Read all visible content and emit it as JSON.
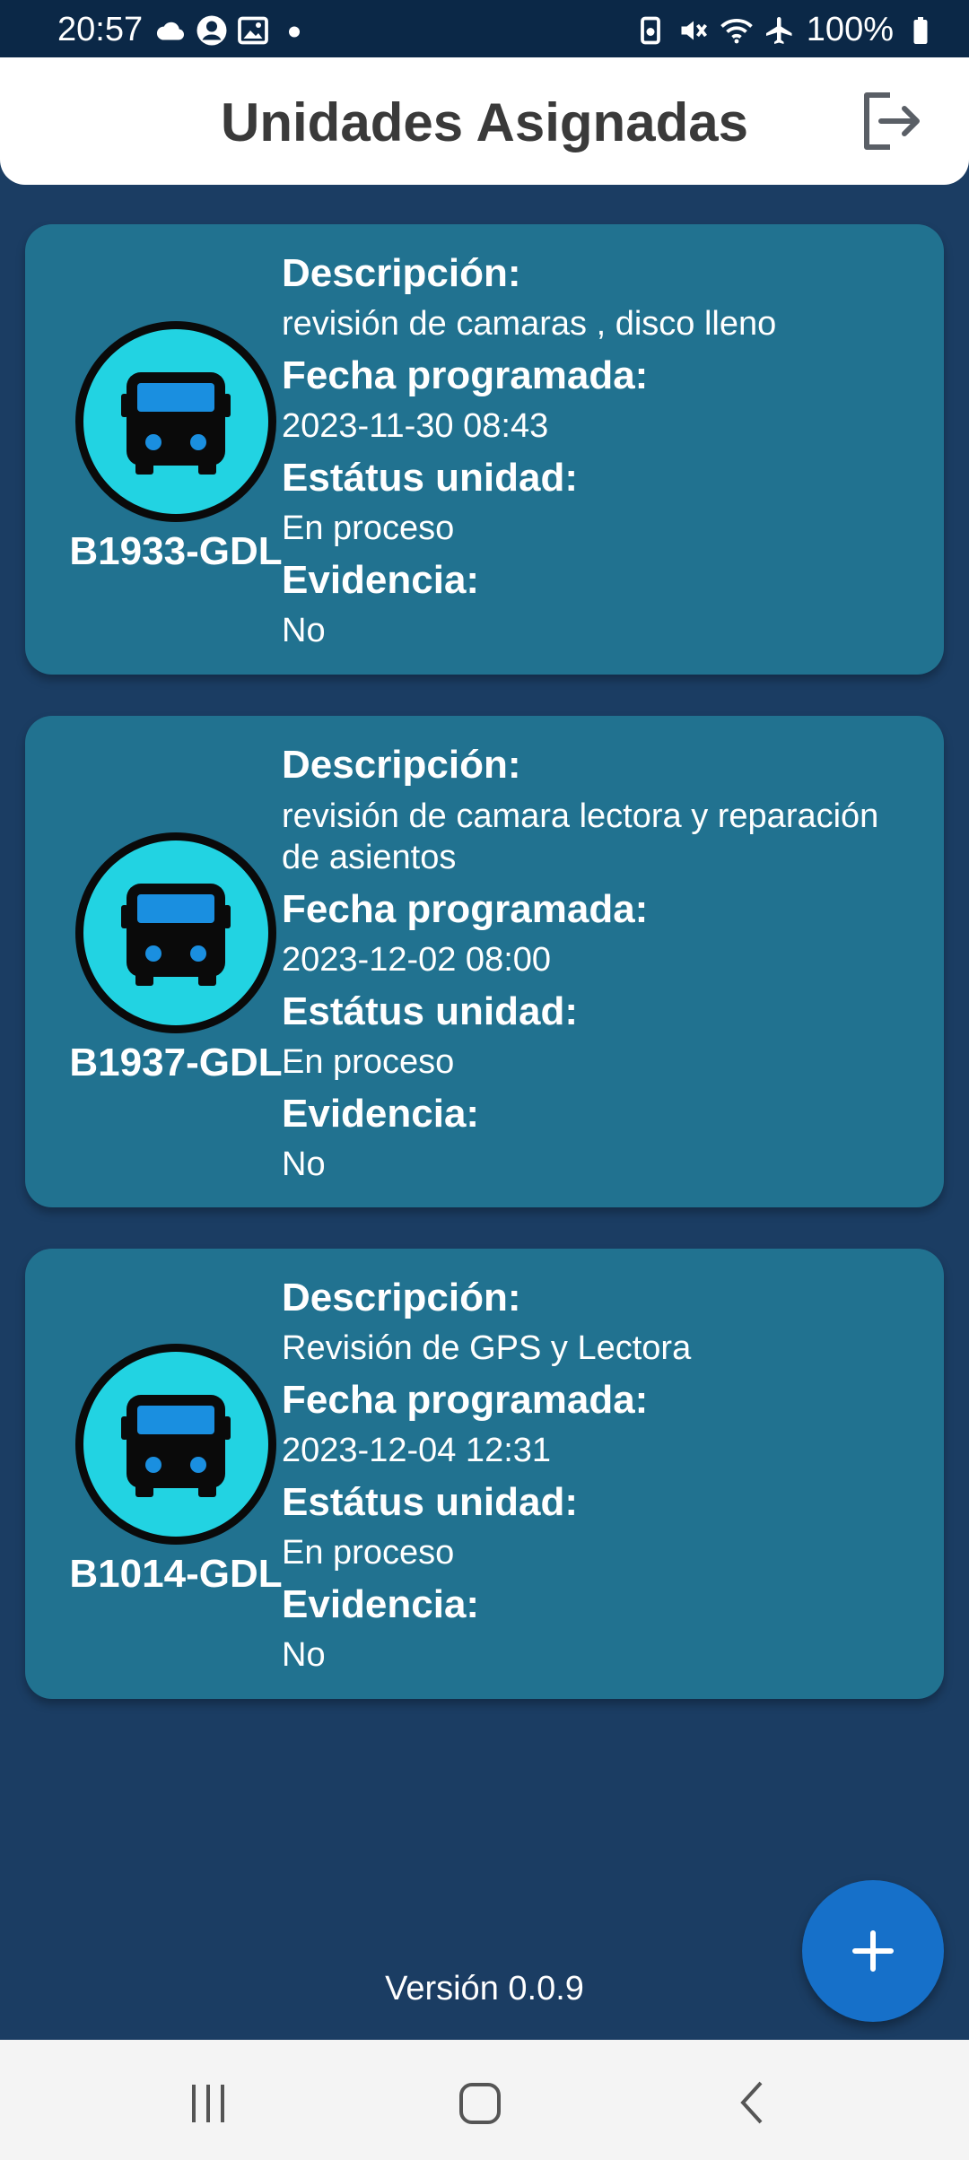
{
  "status_bar": {
    "time": "20:57",
    "battery": "100%",
    "icons_left": [
      "cloud-icon",
      "account-icon",
      "image-icon",
      "dot-icon"
    ],
    "icons_right": [
      "nfc-icon",
      "mute-icon",
      "wifi-icon",
      "airplane-icon",
      "battery-icon"
    ]
  },
  "header": {
    "title": "Unidades Asignadas",
    "logout_icon": "logout-icon"
  },
  "labels": {
    "descripcion": "Descripción:",
    "fecha": "Fecha programada:",
    "estatus": "Estátus unidad:",
    "evidencia": "Evidencia:"
  },
  "cards": [
    {
      "unit": "B1933-GDL",
      "descripcion": "revisión de camaras , disco lleno",
      "fecha": "2023-11-30  08:43",
      "estatus": "En proceso",
      "evidencia": "No"
    },
    {
      "unit": "B1937-GDL",
      "descripcion": "revisión de camara lectora y reparación de asientos",
      "fecha": "2023-12-02  08:00",
      "estatus": "En proceso",
      "evidencia": "No"
    },
    {
      "unit": "B1014-GDL",
      "descripcion": "Revisión de GPS y Lectora",
      "fecha": "2023-12-04  12:31",
      "estatus": "En proceso",
      "evidencia": "No"
    }
  ],
  "footer": {
    "version": "Versión 0.0.9",
    "fab_icon": "plus-icon"
  },
  "colors": {
    "background": "#1b3d63",
    "card": "#217290",
    "avatar": "#22d3e2",
    "fab": "#1670c9",
    "status_bar": "#0b2847"
  }
}
